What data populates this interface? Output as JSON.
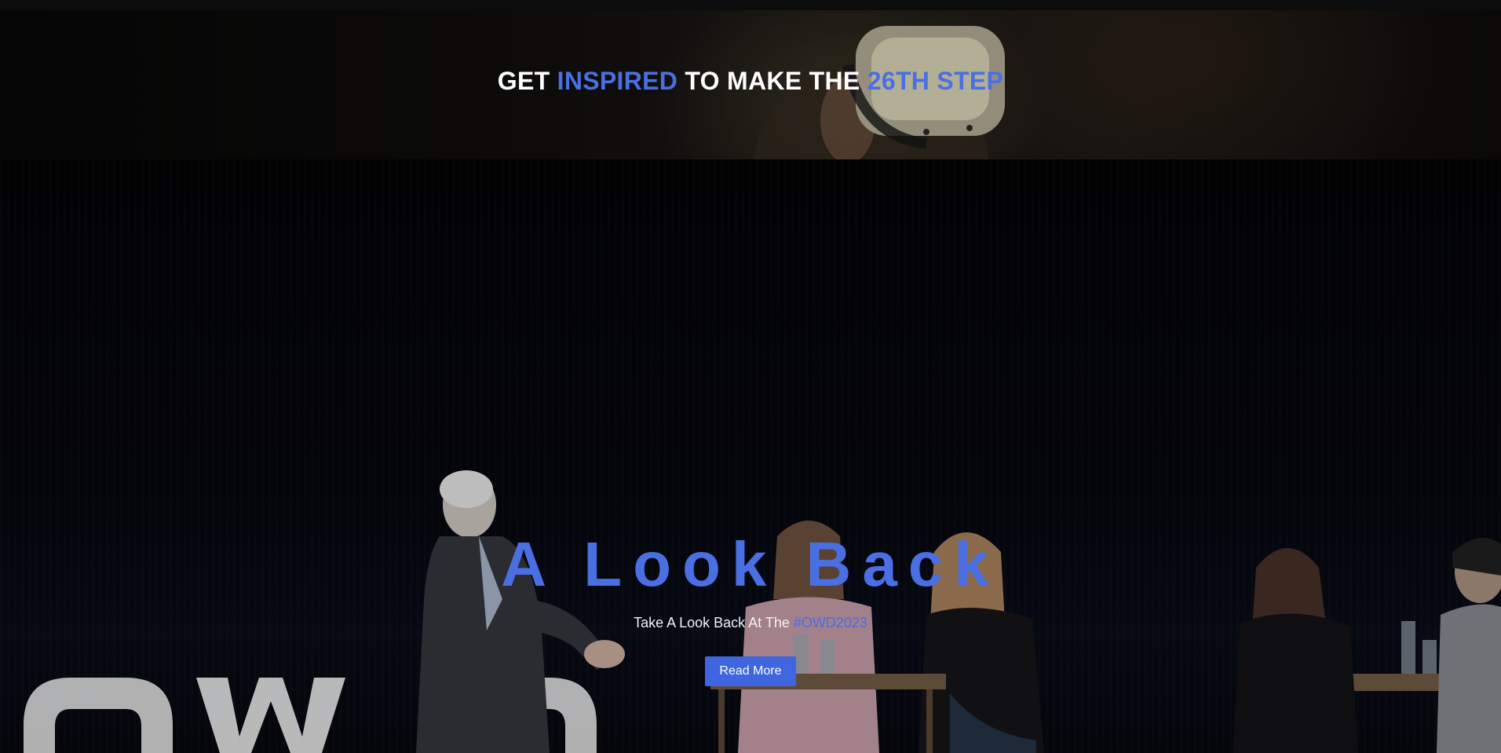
{
  "banner": {
    "parts": [
      {
        "text": "GET ",
        "accent": false
      },
      {
        "text": "INSPIRED",
        "accent": true
      },
      {
        "text": " TO MAKE THE ",
        "accent": false
      },
      {
        "text": "26TH STEP",
        "accent": true
      }
    ]
  },
  "hero": {
    "title": "A Look Back",
    "subtitle_prefix": "Take A Look Back At The ",
    "subtitle_hashtag": "#OWD2023",
    "button_label": "Read More",
    "stage_letters": "OWD"
  },
  "colors": {
    "accent": "#4a6fe3",
    "button": "#3f66e0",
    "background": "#000000",
    "text": "#ffffff"
  }
}
